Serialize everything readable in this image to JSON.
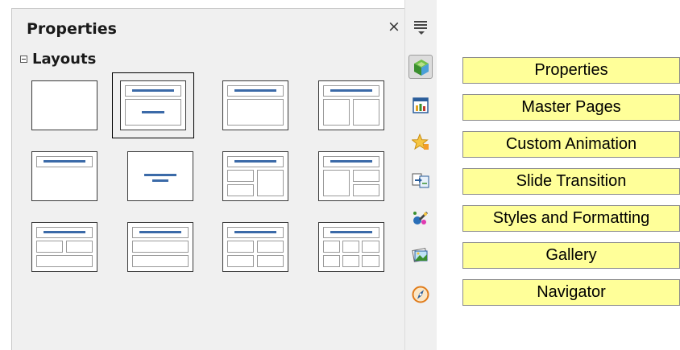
{
  "deck": {
    "title": "Properties",
    "close_glyph": "×",
    "section": "Layouts",
    "layouts": [
      {
        "name": "Blank Slide",
        "selected": false
      },
      {
        "name": "Title Slide",
        "selected": true
      },
      {
        "name": "Title, Content",
        "selected": false
      },
      {
        "name": "Title and 2 Content",
        "selected": false
      },
      {
        "name": "Title Only",
        "selected": false
      },
      {
        "name": "Centered Text",
        "selected": false
      },
      {
        "name": "Title, 2 Content and Content",
        "selected": false
      },
      {
        "name": "Title, Content and 2 Content",
        "selected": false
      },
      {
        "name": "Title, 2 Content over Content",
        "selected": false
      },
      {
        "name": "Title, Content over Content",
        "selected": false
      },
      {
        "name": "Title, 4 Content",
        "selected": false
      },
      {
        "name": "Title, 6 Content",
        "selected": false
      }
    ]
  },
  "tabbar": {
    "menu_icon": "sidebar-menu-icon",
    "tabs": [
      {
        "icon": "properties-icon",
        "active": true
      },
      {
        "icon": "master-pages-icon",
        "active": false
      },
      {
        "icon": "custom-animation-icon",
        "active": false
      },
      {
        "icon": "slide-transition-icon",
        "active": false
      },
      {
        "icon": "styles-formatting-icon",
        "active": false
      },
      {
        "icon": "gallery-icon",
        "active": false
      },
      {
        "icon": "navigator-icon",
        "active": false
      }
    ]
  },
  "labels": [
    "Properties",
    "Master Pages",
    "Custom Animation",
    "Slide Transition",
    "Styles and Formatting",
    "Gallery",
    "Navigator"
  ],
  "colors": {
    "label_bg": "#ffff99",
    "title_bar": "#3b6aa8",
    "selected_tab": "#dcdcdc"
  }
}
